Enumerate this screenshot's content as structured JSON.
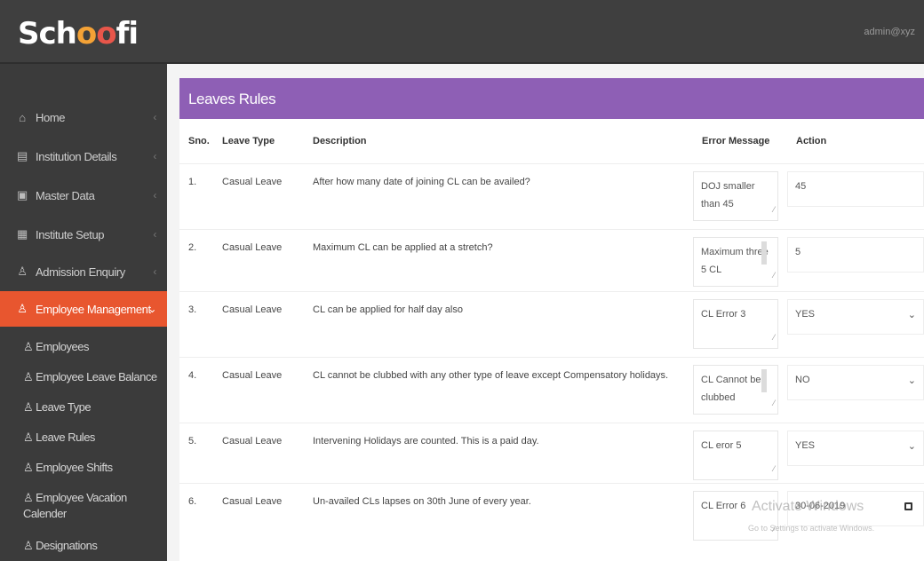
{
  "header": {
    "logo": "Schoofi",
    "user": "admin@xyz"
  },
  "sidebar": {
    "items": [
      {
        "label": "Home",
        "icon": "home-icon",
        "glyph": "⌂"
      },
      {
        "label": "Institution Details",
        "icon": "grid-icon",
        "glyph": "▤"
      },
      {
        "label": "Master Data",
        "icon": "table-icon",
        "glyph": "▣"
      },
      {
        "label": "Institute Setup",
        "icon": "settings-icon",
        "glyph": "▦"
      },
      {
        "label": "Admission Enquiry",
        "icon": "user-icon",
        "glyph": "♙"
      },
      {
        "label": "Employee Management",
        "icon": "user-icon",
        "glyph": "♙"
      }
    ],
    "subitems": [
      {
        "label": "Employees"
      },
      {
        "label": "Employee Leave Balance"
      },
      {
        "label": "Leave Type"
      },
      {
        "label": "Leave Rules"
      },
      {
        "label": "Employee Shifts"
      },
      {
        "label": "Employee Vacation Calender"
      },
      {
        "label": "Designations"
      }
    ]
  },
  "panel": {
    "title": "Leaves Rules",
    "columns": [
      "Sno.",
      "Leave Type",
      "Description",
      "Error Message",
      "Action"
    ],
    "rows": [
      {
        "sno": "1.",
        "type": "Casual Leave",
        "desc": "After how many date of joining CL can be availed?",
        "error": "DOJ smaller than 45",
        "action": "45",
        "kind": "text"
      },
      {
        "sno": "2.",
        "type": "Casual Leave",
        "desc": "Maximum CL can be applied at a stretch?",
        "error": "Maximum three 5 CL",
        "action": "5",
        "kind": "text"
      },
      {
        "sno": "3.",
        "type": "Casual Leave",
        "desc": "CL can be applied for half day also",
        "error": "CL Error 3",
        "action": "YES",
        "kind": "select"
      },
      {
        "sno": "4.",
        "type": "Casual Leave",
        "desc": "CL cannot be clubbed with any other type of leave except Compensatory holidays.",
        "error": "CL Cannot be clubbed",
        "action": "NO",
        "kind": "select"
      },
      {
        "sno": "5.",
        "type": "Casual Leave",
        "desc": "Intervening Holidays are counted. This is a paid day.",
        "error": "CL eror 5",
        "action": "YES",
        "kind": "select"
      },
      {
        "sno": "6.",
        "type": "Casual Leave",
        "desc": "Un-availed CLs lapses on 30th June of every year.",
        "error": "CL Error 6",
        "action": "30-06-2019",
        "kind": "date"
      }
    ]
  },
  "watermark": {
    "line1": "Activate Windows",
    "line2": "Go to Settings to activate Windows."
  },
  "colors": {
    "accent": "#8e5fb5",
    "active": "#e8562f"
  }
}
